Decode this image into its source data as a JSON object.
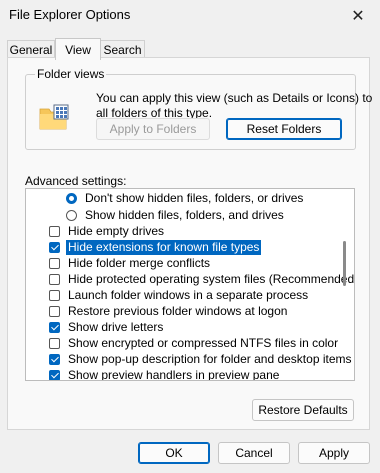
{
  "window": {
    "title": "File Explorer Options",
    "close_glyph": "✕"
  },
  "tabs": [
    {
      "label": "General"
    },
    {
      "label": "View"
    },
    {
      "label": "Search"
    }
  ],
  "folder_views": {
    "group_label": "Folder views",
    "description": "You can apply this view (such as Details or Icons) to all folders of this type.",
    "apply_button": "Apply to Folders",
    "reset_button": "Reset Folders"
  },
  "advanced": {
    "label": "Advanced settings:",
    "items": [
      {
        "type": "radio",
        "checked": true,
        "label": "Don't show hidden files, folders, or drives"
      },
      {
        "type": "radio",
        "checked": false,
        "label": "Show hidden files, folders, and drives"
      },
      {
        "type": "checkbox",
        "checked": false,
        "label": "Hide empty drives"
      },
      {
        "type": "checkbox",
        "checked": true,
        "label": "Hide extensions for known file types",
        "selected": true
      },
      {
        "type": "checkbox",
        "checked": false,
        "label": "Hide folder merge conflicts"
      },
      {
        "type": "checkbox",
        "checked": false,
        "label": "Hide protected operating system files (Recommended)"
      },
      {
        "type": "checkbox",
        "checked": false,
        "label": "Launch folder windows in a separate process"
      },
      {
        "type": "checkbox",
        "checked": false,
        "label": "Restore previous folder windows at logon"
      },
      {
        "type": "checkbox",
        "checked": true,
        "label": "Show drive letters"
      },
      {
        "type": "checkbox",
        "checked": false,
        "label": "Show encrypted or compressed NTFS files in color"
      },
      {
        "type": "checkbox",
        "checked": true,
        "label": "Show pop-up description for folder and desktop items"
      },
      {
        "type": "checkbox",
        "checked": true,
        "label": "Show preview handlers in preview pane"
      }
    ],
    "restore_button": "Restore Defaults"
  },
  "footer": {
    "ok": "OK",
    "cancel": "Cancel",
    "apply": "Apply"
  },
  "colors": {
    "accent": "#0067c0"
  }
}
